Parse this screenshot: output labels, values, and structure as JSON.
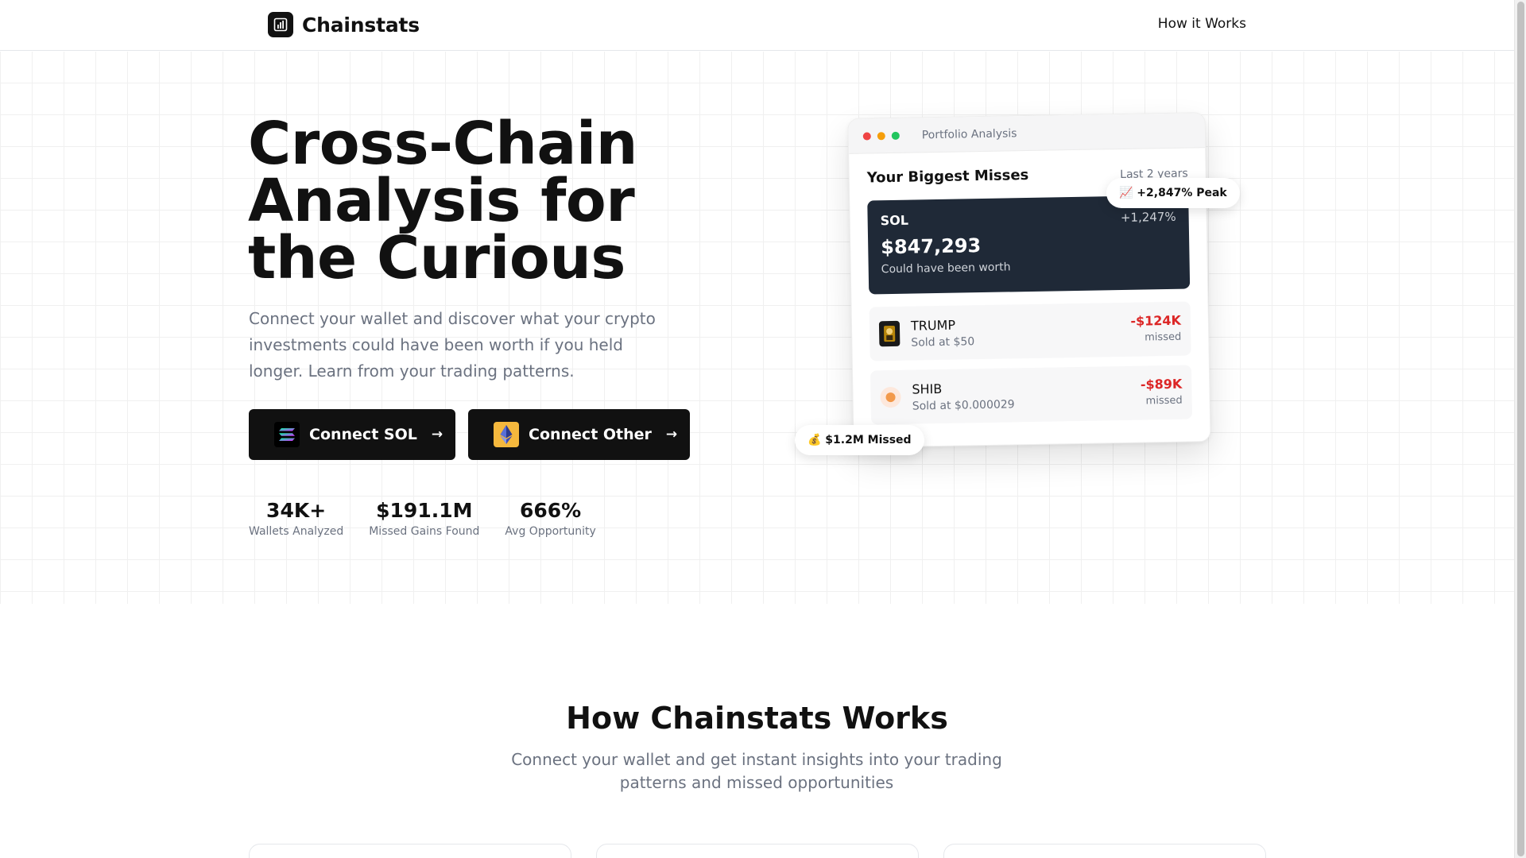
{
  "header": {
    "brand": "Chainstats",
    "nav_link": "How it Works"
  },
  "hero": {
    "title": "Cross-Chain Analysis for the Curious",
    "subtitle": "Connect your wallet and discover what your crypto investments could have been worth if you held longer. Learn from your trading patterns.",
    "buttons": [
      {
        "label": "Connect SOL",
        "icon": "solana-logo-icon"
      },
      {
        "label": "Connect Other",
        "icon": "ethereum-logo-icon"
      }
    ],
    "stats": [
      {
        "value": "34K+",
        "label": "Wallets Analyzed"
      },
      {
        "value": "$191.1M",
        "label": "Missed Gains Found"
      },
      {
        "value": "666%",
        "label": "Avg Opportunity"
      }
    ]
  },
  "preview_card": {
    "window_title": "Portfolio Analysis",
    "heading": "Your Biggest Misses",
    "range": "Last 2 years",
    "highlight": {
      "token": "SOL",
      "change": "+1,247%",
      "value": "$847,293",
      "note": "Could have been worth"
    },
    "rows": [
      {
        "token": "TRUMP",
        "sold": "Sold at $50",
        "loss": "-$124K",
        "missed": "missed"
      },
      {
        "token": "SHIB",
        "sold": "Sold at $0.000029",
        "loss": "-$89K",
        "missed": "missed"
      }
    ],
    "badge_peak": "📈 +2,847% Peak",
    "badge_missed": "💰 $1.2M Missed"
  },
  "how": {
    "title": "How Chainstats Works",
    "subtitle": "Connect your wallet and get instant insights into your trading patterns and missed opportunities"
  },
  "colors": {
    "brand_dark": "#111111",
    "loss_red": "#dc2626",
    "card_dark": "#1f2937"
  }
}
